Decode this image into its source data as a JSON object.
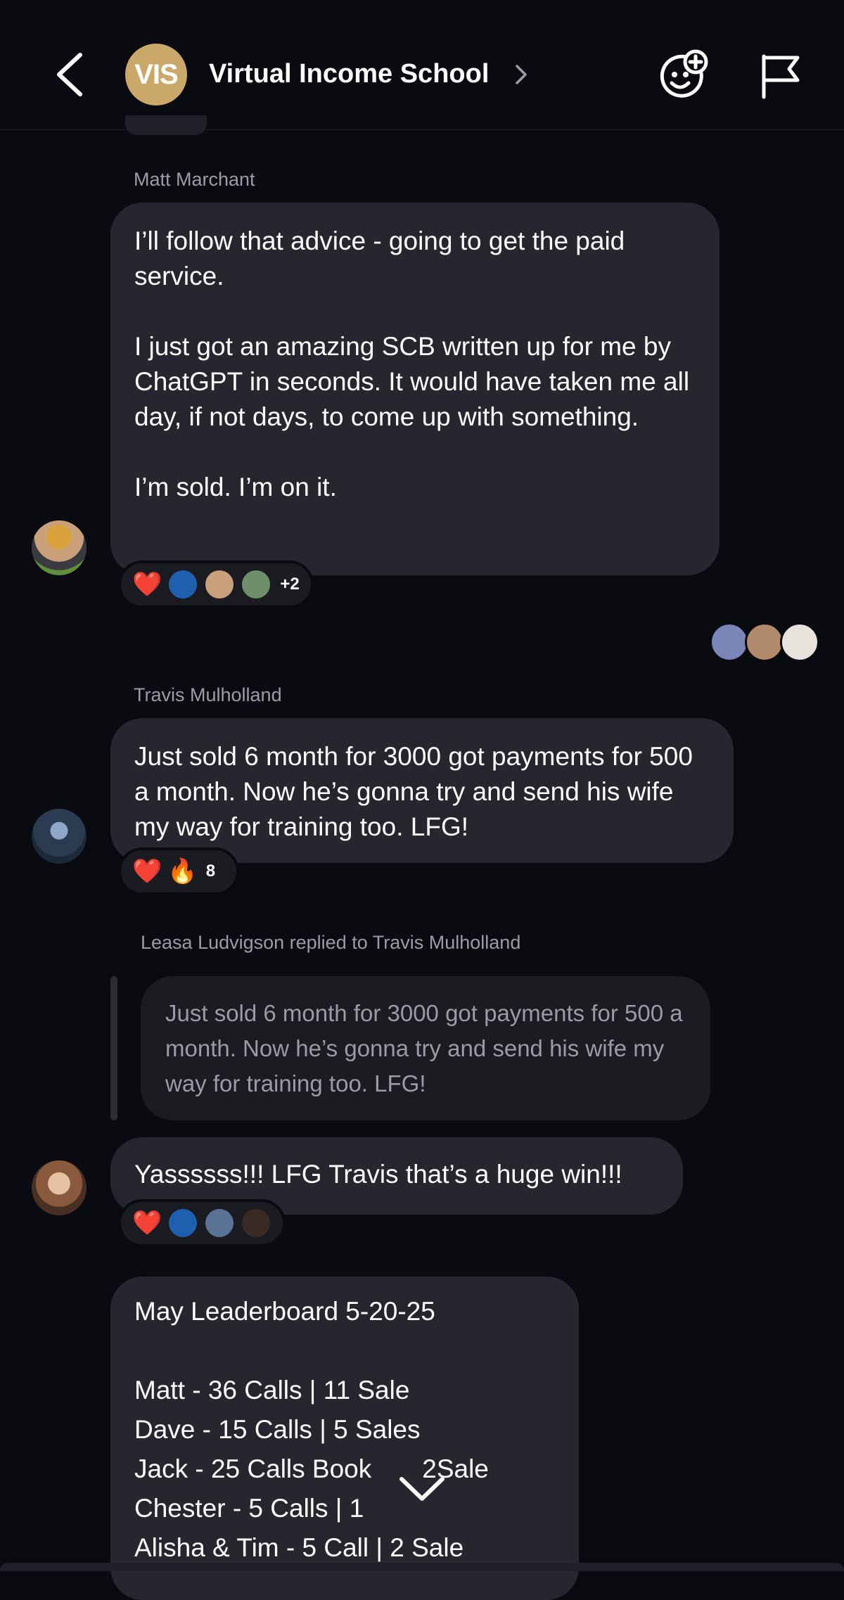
{
  "header": {
    "avatar_initials": "VIS",
    "title": "Virtual Income School",
    "back_icon": "chevron-left-icon",
    "add_reaction_icon": "emoji-add-icon",
    "report_icon": "flag-icon"
  },
  "messages": [
    {
      "sender": "Matt Marchant",
      "paragraphs": [
        "I’ll follow that advice - going to get the paid service.",
        "I just got an amazing SCB written up for me by ChatGPT in seconds. It would have taken me all day, if not days, to come up with something.",
        "I’m sold. I’m on it."
      ],
      "reactions": {
        "emoji": "❤️",
        "extra_count": "+2"
      }
    },
    {
      "sender": "Travis Mulholland",
      "paragraphs": [
        "Just sold 6 month for 3000 got payments for 500 a month. Now he’s gonna try and send his wife my way for training too. LFG!"
      ],
      "reactions": {
        "emoji": "❤️",
        "emoji2": "🔥",
        "count": "8"
      }
    },
    {
      "reply_label": "Leasa Ludvigson replied to Travis Mulholland",
      "quoted": "Just sold 6 month for 3000 got payments for 500 a month. Now he’s gonna try and send his wife my way for training too. LFG!",
      "text": "Yassssss!!! LFG Travis that’s a huge win!!!",
      "reactions": {
        "emoji": "❤️"
      }
    },
    {
      "title": "May Leaderboard 5-20-25",
      "lines": [
        "Matt - 36 Calls | 11 Sale",
        "Dave - 15 Calls | 5 Sales",
        "Jack - 25 Calls Book",
        "2Sale",
        "Chester - 5 Calls | 1",
        "Alisha & Tim - 5 Call | 2 Sale"
      ]
    }
  ],
  "colors": {
    "background": "#0a0b10",
    "bubble": "#26272e",
    "accent_avatar": "#c9a86a",
    "heart": "#e3243b"
  }
}
